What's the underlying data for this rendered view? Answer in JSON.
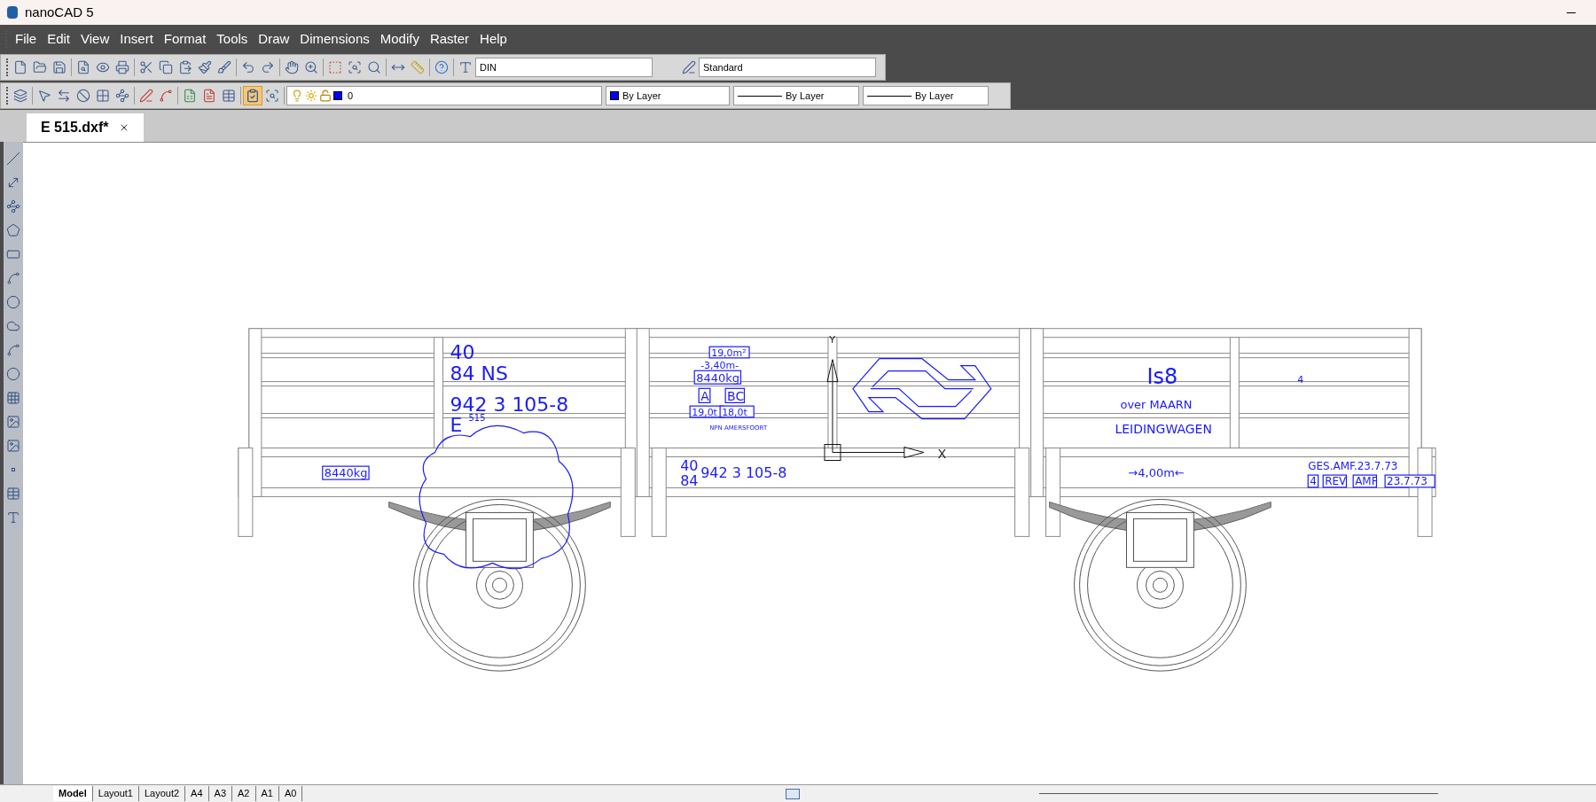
{
  "window": {
    "title": "nanoCAD 5"
  },
  "menu": [
    "File",
    "Edit",
    "View",
    "Insert",
    "Format",
    "Tools",
    "Draw",
    "Dimensions",
    "Modify",
    "Raster",
    "Help"
  ],
  "toolbar": {
    "text_style": "DIN",
    "dim_style": "Standard",
    "layer": "0",
    "color_setting": "By Layer",
    "linetype": "By Layer",
    "lineweight": "By Layer"
  },
  "document_tabs": [
    {
      "label": "E 515.dxf*",
      "selected": true
    }
  ],
  "drawing": {
    "labels": [
      {
        "text": "40",
        "boxed": false
      },
      {
        "text": "84 NS",
        "boxed": false
      },
      {
        "text": "942 3 105-8",
        "boxed": false
      },
      {
        "text": "E",
        "boxed": false
      },
      {
        "text": "515",
        "boxed": false
      },
      {
        "text": "8440kg",
        "boxed": true
      },
      {
        "text": "19,0m²",
        "boxed": true
      },
      {
        "text": "-3,40m-",
        "boxed": false
      },
      {
        "text": "8440kg",
        "boxed": true
      },
      {
        "text": "A",
        "boxed": true
      },
      {
        "text": "BC",
        "boxed": true
      },
      {
        "text": "19,0t",
        "boxed": true
      },
      {
        "text": "18,0t",
        "boxed": true
      },
      {
        "text": "NPN AMERSFOORT",
        "boxed": false
      },
      {
        "text": "40",
        "boxed": false
      },
      {
        "text": "84",
        "boxed": false
      },
      {
        "text": "942 3 105-8",
        "boxed": false
      },
      {
        "text": "Is8",
        "boxed": false
      },
      {
        "text": "4",
        "boxed": false
      },
      {
        "text": "over MAARN",
        "boxed": false
      },
      {
        "text": "LEIDINGWAGEN",
        "boxed": false
      },
      {
        "text": "→4,00m←",
        "boxed": false
      },
      {
        "text": "GES.AMF.23.7.73",
        "boxed": false
      },
      {
        "text": "4",
        "boxed": true
      },
      {
        "text": "REV",
        "boxed": true
      },
      {
        "text": "AMF",
        "boxed": true
      },
      {
        "text": "23.7.73",
        "boxed": true
      }
    ],
    "ucs": {
      "x_label": "X",
      "y_label": "Y"
    }
  },
  "layout_tabs": [
    {
      "label": "Model",
      "selected": true
    },
    {
      "label": "Layout1",
      "selected": false
    },
    {
      "label": "Layout2",
      "selected": false
    },
    {
      "label": "A4",
      "selected": false
    },
    {
      "label": "A3",
      "selected": false
    },
    {
      "label": "A2",
      "selected": false
    },
    {
      "label": "A1",
      "selected": false
    },
    {
      "label": "A0",
      "selected": false
    }
  ]
}
